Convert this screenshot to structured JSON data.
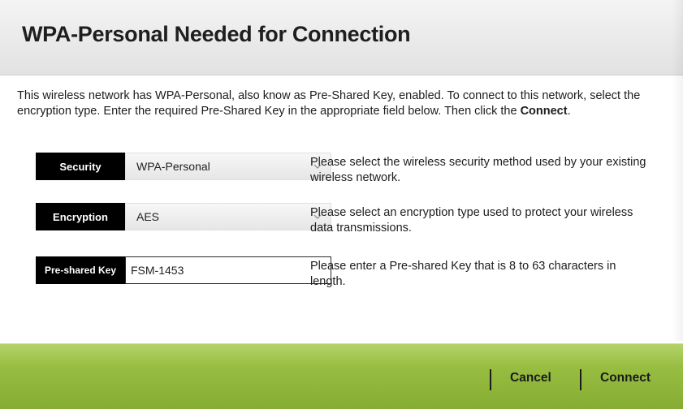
{
  "dialog": {
    "title": "WPA-Personal Needed for Connection",
    "intro_text": "This wireless network has WPA-Personal, also know as Pre-Shared Key, enabled. To connect to this network, select the encryption type. Enter the required Pre-Shared Key in the appropriate field below. Then click the ",
    "intro_bold": "Connect",
    "intro_end": "."
  },
  "form": {
    "security": {
      "label": "Security",
      "value": "WPA-Personal",
      "help": "Please select the wireless security method used by your existing wireless network."
    },
    "encryption": {
      "label": "Encryption",
      "value": "AES",
      "help": "Please select an encryption type used to protect your wireless data transmissions."
    },
    "psk": {
      "label": "Pre-shared Key",
      "value": "FSM-1453",
      "help": "Please enter a Pre-shared Key that is 8 to 63 characters in length."
    }
  },
  "footer": {
    "cancel_label": "Cancel",
    "connect_label": "Connect"
  },
  "icons": {
    "dropdown": "chevron-down-icon"
  },
  "colors": {
    "footer_green": "#97bd41",
    "label_black": "#000000"
  }
}
